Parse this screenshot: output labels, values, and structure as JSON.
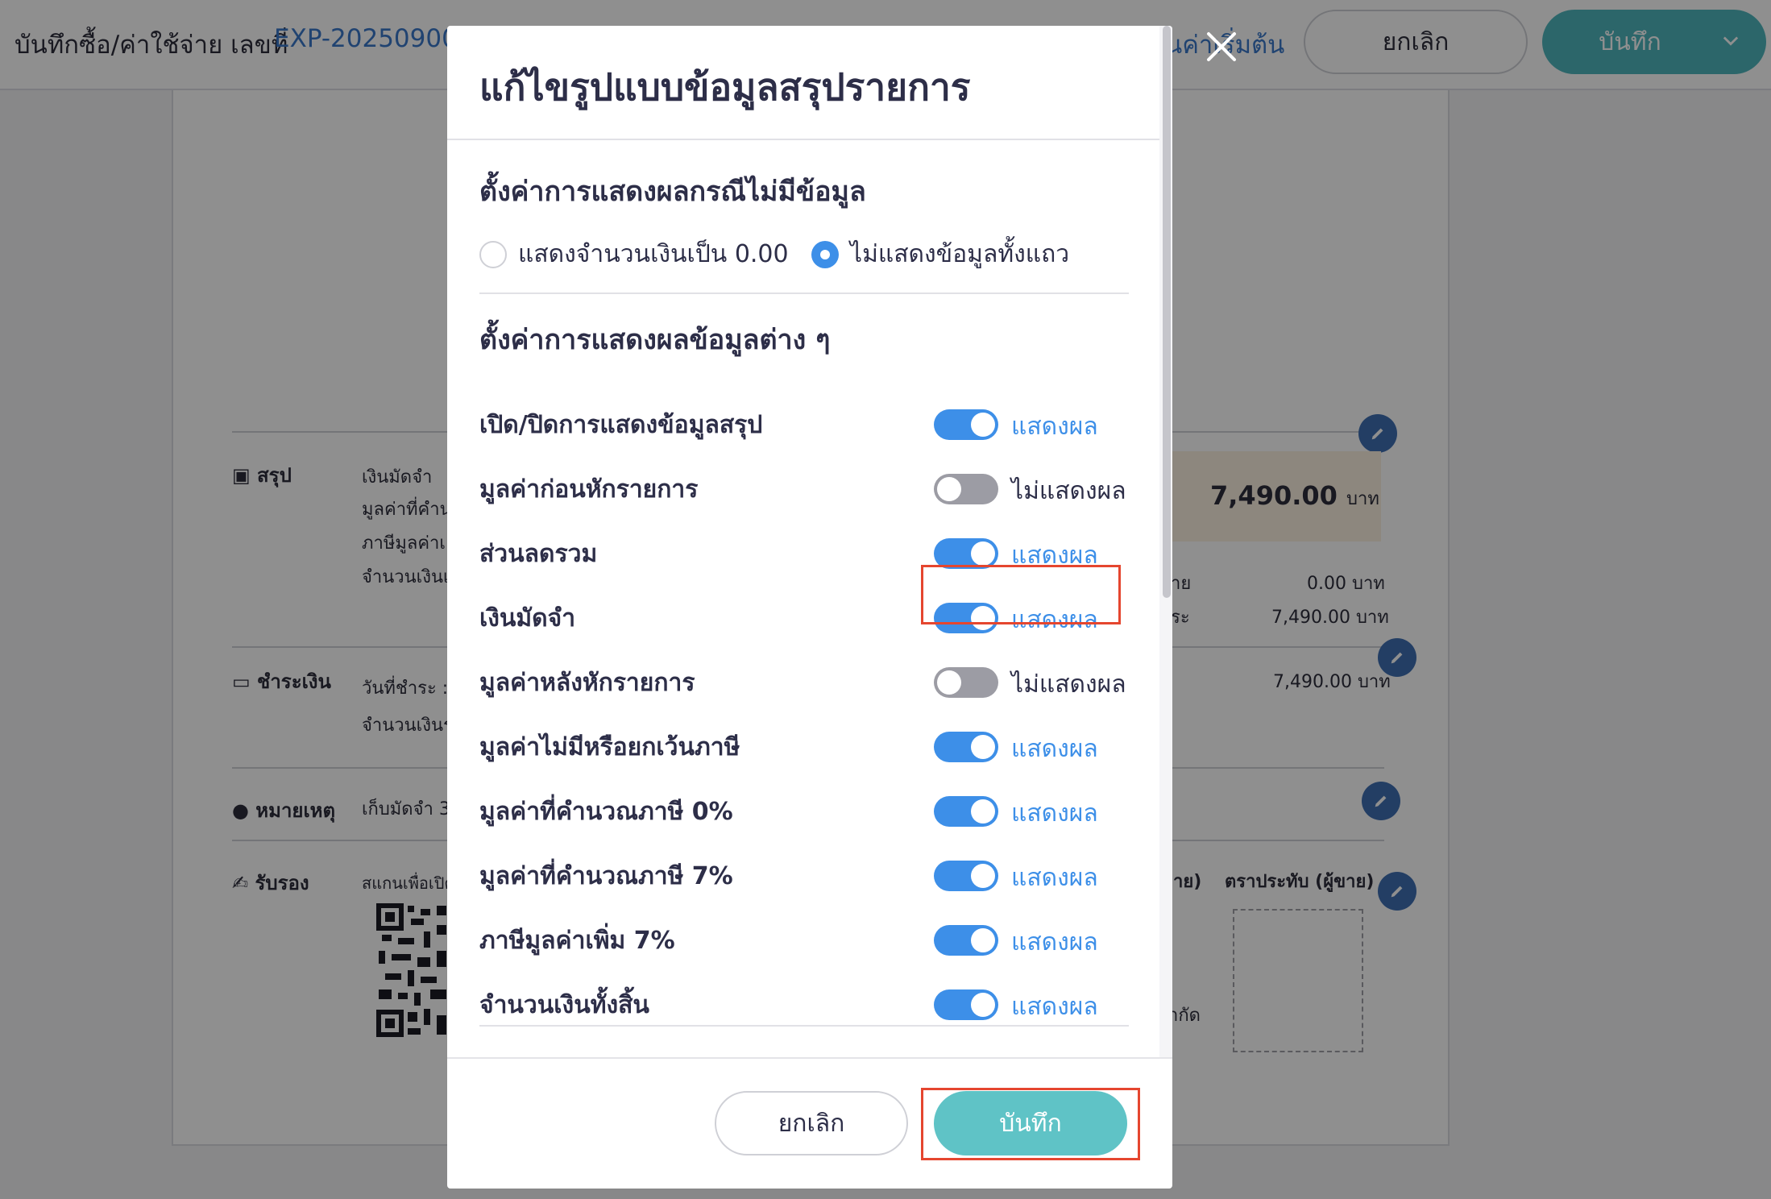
{
  "page": {
    "doc_title": "บันทึกซื้อ/ค่าใช้จ่าย เลขที่",
    "doc_number": "EXP-20250900",
    "reset_link": "ินค่าเริ่มต้น",
    "cancel_label": "ยกเลิก",
    "save_label": "บันทึก"
  },
  "background": {
    "summary_label": "สรุป",
    "summary_lines": [
      "เงินมัดจำ",
      "มูลค่าที่คำน",
      "ภาษีมูลค่าเ",
      "จำนวนเงินเ"
    ],
    "grand_total": "7,490.00",
    "grand_total_unit": "บาท",
    "right_labels": [
      "าย",
      "ระ"
    ],
    "amounts": [
      "0.00 บาท",
      "7,490.00 บาท"
    ],
    "payment_label": "ชำระเงิน",
    "payment_lines": [
      "วันที่ชำระ :",
      "จำนวนเงินร"
    ],
    "payment_amount": "7,490.00 บาท",
    "note_label": "หมายเหตุ",
    "note_text": "เก็บมัดจำ 3",
    "approve_label": "รับรอง",
    "scan_text": "สแกนเพื่อเปิด",
    "seller_label": "ขาย)",
    "stamp_label": "ตราประทับ (ผู้ขาย)",
    "company_suffix": "ากัด"
  },
  "modal": {
    "title": "แก้ไขรูปแบบข้อมูลสรุปรายการ",
    "empty_section_title": "ตั้งค่าการแสดงผลกรณีไม่มีข้อมูล",
    "radio_options": [
      {
        "label": "แสดงจำนวนเงินเป็น 0.00",
        "checked": false
      },
      {
        "label": "ไม่แสดงข้อมูลทั้งแถว",
        "checked": true
      }
    ],
    "fields_section_title": "ตั้งค่าการแสดงผลข้อมูลต่าง ๆ",
    "rows": [
      {
        "label": "เปิด/ปิดการแสดงข้อมูลสรุป",
        "on": true,
        "state": "แสดงผล"
      },
      {
        "label": "มูลค่าก่อนหักรายการ",
        "on": false,
        "state": "ไม่แสดงผล"
      },
      {
        "label": "ส่วนลดรวม",
        "on": true,
        "state": "แสดงผล"
      },
      {
        "label": "เงินมัดจำ",
        "on": true,
        "state": "แสดงผล"
      },
      {
        "label": "มูลค่าหลังหักรายการ",
        "on": false,
        "state": "ไม่แสดงผล"
      },
      {
        "label": "มูลค่าไม่มีหรือยกเว้นภาษี",
        "on": true,
        "state": "แสดงผล"
      },
      {
        "label": "มูลค่าที่คำนวณภาษี 0%",
        "on": true,
        "state": "แสดงผล"
      },
      {
        "label": "มูลค่าที่คำนวณภาษี 7%",
        "on": true,
        "state": "แสดงผล"
      },
      {
        "label": "ภาษีมูลค่าเพิ่ม 7%",
        "on": true,
        "state": "แสดงผล"
      },
      {
        "label": "จำนวนเงินทั้งสิ้น",
        "on": true,
        "state": "แสดงผล"
      }
    ],
    "cancel_label": "ยกเลิก",
    "save_label": "บันทึก"
  },
  "colors": {
    "accent": "#3d8fe8",
    "save_button": "#5fc3c6",
    "highlight": "#e5462f"
  }
}
